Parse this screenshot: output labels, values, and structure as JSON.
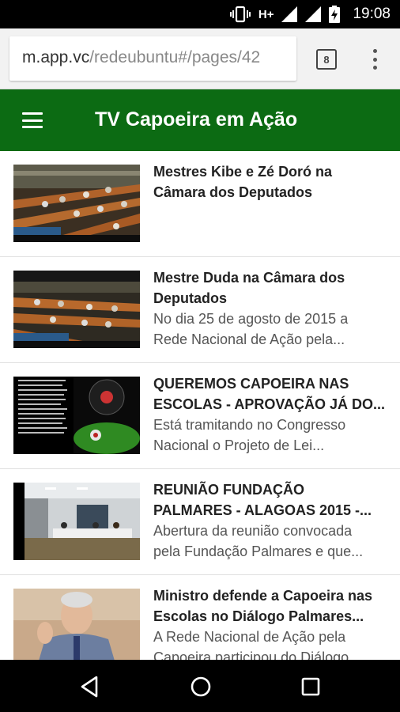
{
  "status_bar": {
    "network": "H+",
    "time": "19:08",
    "icons": [
      "vibrate-icon",
      "signal-icon",
      "signal-icon",
      "battery-charging-icon"
    ]
  },
  "browser": {
    "url_host": "m.app.vc",
    "url_path": "/redeubuntu#/pages/42",
    "tab_count": "8",
    "menu_icon": "overflow-menu-icon"
  },
  "app_bar": {
    "title": "TV Capoeira em Ação",
    "menu_icon": "hamburger-icon"
  },
  "items": [
    {
      "title": "Mestres Kibe e Zé Doró na\nCâmara dos Deputados",
      "desc": ""
    },
    {
      "title": "Mestre Duda na Câmara dos\nDeputados",
      "desc": "No dia 25 de agosto de 2015 a\nRede Nacional de Ação pela..."
    },
    {
      "title": "QUEREMOS CAPOEIRA NAS\nESCOLAS - APROVAÇÃO JÁ DO...",
      "desc": "Está tramitando no Congresso\nNacional o Projeto de Lei..."
    },
    {
      "title": "REUNIÃO FUNDAÇÃO\nPALMARES - ALAGOAS 2015 -...",
      "desc": "Abertura da reunião convocada\npela Fundação Palmares e que..."
    },
    {
      "title": "Ministro defende a Capoeira nas\nEscolas no Diálogo Palmares...",
      "desc": "A Rede Nacional de Ação pela\nCapoeira participou do Diálogo..."
    }
  ],
  "nav_bar": {
    "back_icon": "back-triangle-icon",
    "home_icon": "home-circle-icon",
    "recent_icon": "recents-square-icon"
  },
  "colors": {
    "app_bar": "#0c6b13",
    "status_bar": "#000000",
    "browser_bar": "#f2f2f2"
  }
}
